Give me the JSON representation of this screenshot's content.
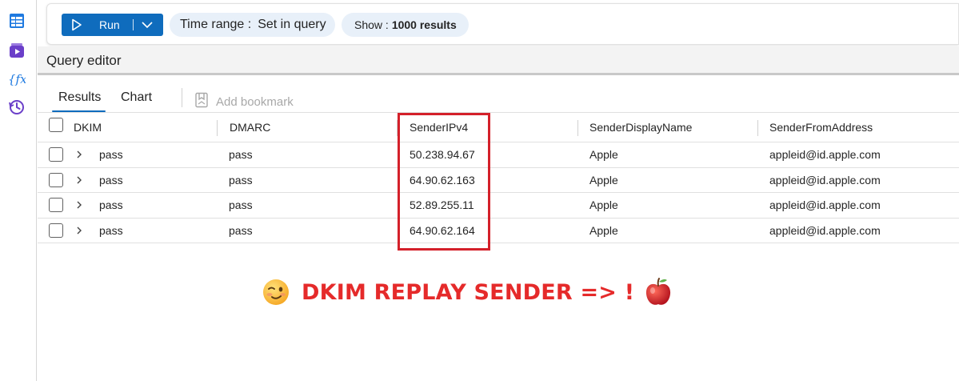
{
  "toolbar": {
    "run_label": "Run",
    "time_range_label": "Time range :",
    "time_range_value": "Set in query",
    "show_label": "Show :",
    "show_value": "1000 results"
  },
  "query_editor": {
    "title": "Query editor"
  },
  "tabs": [
    {
      "label": "Results",
      "active": true
    },
    {
      "label": "Chart",
      "active": false
    }
  ],
  "bookmark_label": "Add bookmark",
  "table": {
    "columns": [
      "DKIM",
      "DMARC",
      "SenderIPv4",
      "SenderDisplayName",
      "SenderFromAddress"
    ],
    "rows": [
      [
        "pass",
        "pass",
        "50.238.94.67",
        "Apple",
        "appleid@id.apple.com"
      ],
      [
        "pass",
        "pass",
        "64.90.62.163",
        "Apple",
        "appleid@id.apple.com"
      ],
      [
        "pass",
        "pass",
        "52.89.255.11",
        "Apple",
        "appleid@id.apple.com"
      ],
      [
        "pass",
        "pass",
        "64.90.62.164",
        "Apple",
        "appleid@id.apple.com"
      ]
    ]
  },
  "annotation": {
    "text": "DKIM REPLAY SENDER => !",
    "color": "#e52a2a"
  },
  "colors": {
    "accent": "#0f6cbd",
    "highlight": "#d4202a",
    "pill_bg": "#e8f0f9"
  },
  "icons": [
    "table-icon",
    "media-icon",
    "function-icon",
    "history-icon",
    "play-icon",
    "chevron-down-icon",
    "bookmark-icon",
    "chevron-right-icon",
    "winking-face-emoji",
    "apple-emoji"
  ]
}
